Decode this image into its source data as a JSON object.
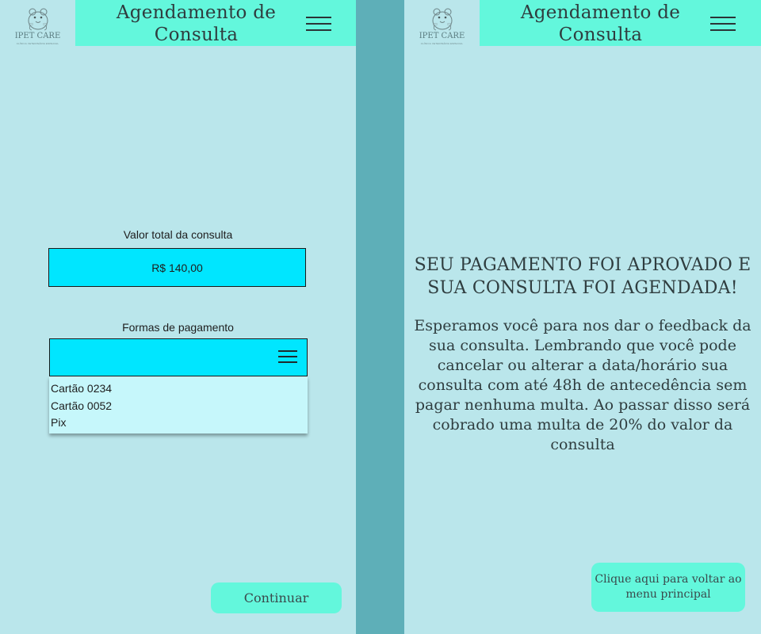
{
  "app": {
    "logo_name": "IPET CARE",
    "logo_tagline": "CLÍNICA VETERINÁRIA ESPECIAL",
    "header_title": "Agendamento de Consulta"
  },
  "payment_screen": {
    "total_label": "Valor total da consulta",
    "total_value": "R$ 140,00",
    "payment_label": "Formas de pagamento",
    "payment_options": [
      "Cartão 0234",
      "Cartão 0052",
      "Pix"
    ],
    "continue_label": "Continuar"
  },
  "confirmation_screen": {
    "title": "SEU PAGAMENTO FOI APROVADO E SUA CONSULTA FOI AGENDADA!",
    "message": "Esperamos você para nos dar o feedback da sua consulta. Lembrando que você pode cancelar ou alterar a data/horário sua consulta com até 48h de antecedência sem pagar nenhuma multa. Ao passar disso será cobrado uma multa de 20% do valor da consulta",
    "back_button_label": "Clique aqui para voltar ao menu principal"
  },
  "colors": {
    "screen_bg": "#bae6eb",
    "divider": "#5eafb8",
    "header_bg": "#63f7dc",
    "field_bg": "#00e6ff",
    "options_bg": "#c6f7fb"
  },
  "icons": {
    "logo": "hamster-icon",
    "menu": "hamburger-menu-icon",
    "select": "hamburger-menu-icon"
  }
}
